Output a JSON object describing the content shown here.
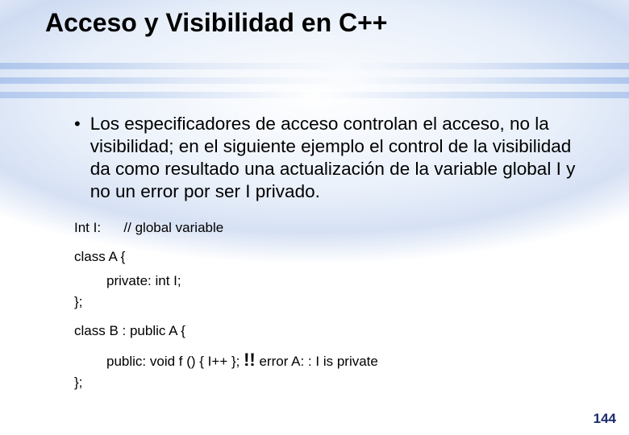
{
  "title": "Acceso y Visibilidad en C++",
  "bullet": "Los especificadores de acceso controlan el acceso, no la visibilidad; en el siguiente ejemplo el control de la visibilidad da como resultado una actualización de la variable global I y no un error por ser I privado.",
  "code": {
    "l1a": "Int I:",
    "l1b": "// global variable",
    "l2": "class A {",
    "l3": "private: int I;",
    "l4": "};",
    "l5": "class B : public A {",
    "l6a": "public: void f () { I++ }; ",
    "l6bang": "!!",
    "l6b": " error A: : I is private",
    "l7": "};"
  },
  "page_number": "144"
}
